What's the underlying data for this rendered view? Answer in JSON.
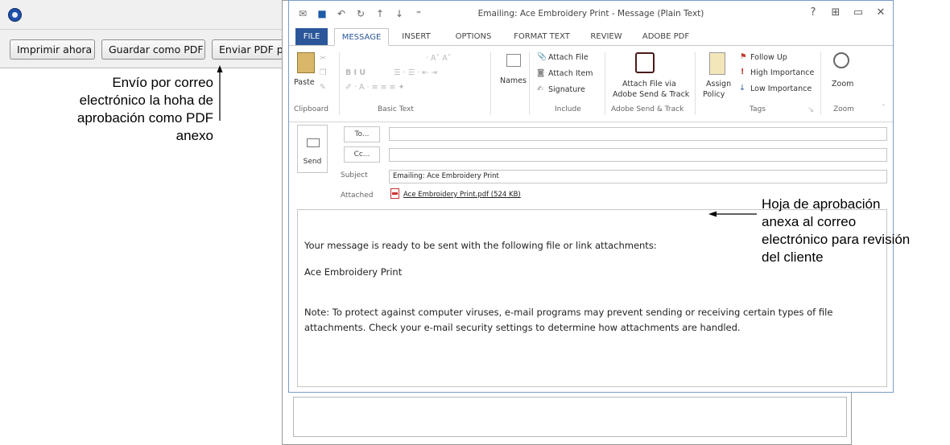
{
  "app": {
    "buttons": [
      "Imprimir ahora",
      "Guardar como PDF",
      "Enviar PDF por"
    ]
  },
  "callouts": {
    "left": [
      "Envío por correo",
      "electrónico la hoha de",
      "aprobación como PDF",
      "anexo"
    ],
    "right": [
      "Hoja de aprobación",
      "anexa al correo",
      "electrónico para revisión",
      "del cliente"
    ]
  },
  "outlook": {
    "title": "Emailing: Ace Embroidery Print - Message (Plain Text)",
    "window_controls": [
      "?",
      "⊞",
      "▭",
      "✕"
    ],
    "tabs": [
      "FILE",
      "MESSAGE",
      "INSERT",
      "OPTIONS",
      "FORMAT TEXT",
      "REVIEW",
      "ADOBE PDF"
    ],
    "ribbon": {
      "paste": "Paste",
      "names": "Names",
      "attach_file": "Attach File",
      "attach_item": "Attach Item",
      "signature": "Signature",
      "attach_adobe_1": "Attach File via",
      "attach_adobe_2": "Adobe Send & Track",
      "assign_1": "Assign",
      "assign_2": "Policy",
      "follow_up": "Follow Up",
      "high_importance": "High Importance",
      "low_importance": "Low Importance",
      "zoom": "Zoom",
      "groups": {
        "clipboard": "Clipboard",
        "basic_text": "Basic Text",
        "include": "Include",
        "adobe": "Adobe Send & Track",
        "tags": "Tags",
        "zoom": "Zoom"
      }
    },
    "form": {
      "send": "Send",
      "to": "To...",
      "cc": "Cc...",
      "subject_label": "Subject",
      "subject_value": "Emailing: Ace Embroidery Print",
      "attached_label": "Attached",
      "attachment": "Ace Embroidery Print.pdf (524 KB)"
    },
    "body": {
      "line1": "Your message is ready to be sent with the following file or link attachments:",
      "line2": "Ace Embroidery Print",
      "line3": "Note: To protect against computer viruses, e-mail programs may prevent sending or receiving certain types of file",
      "line4": "attachments.  Check your e-mail security settings to determine how attachments are handled."
    }
  },
  "colors": {
    "file_tab": "#2b579a",
    "accent": "#2b579a",
    "window_border": "#7a9cc9",
    "follow_flag": "#c0392b"
  }
}
